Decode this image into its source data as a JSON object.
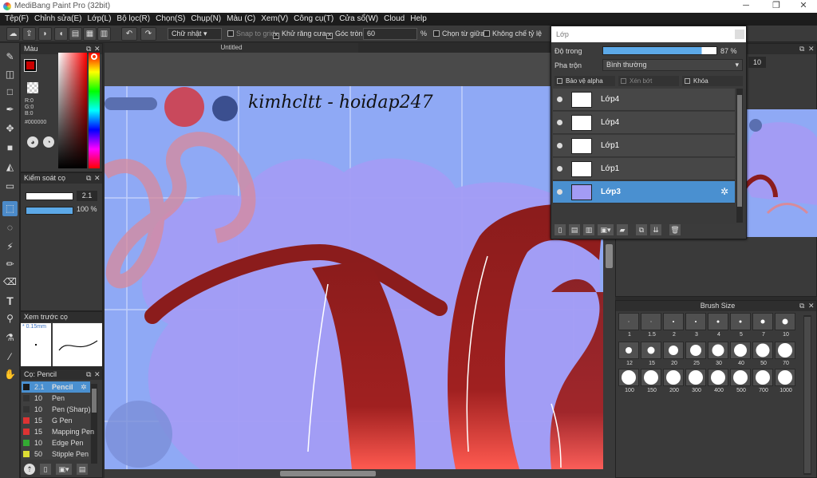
{
  "window": {
    "title": "MediBang Paint Pro (32bit)",
    "minimize": "─",
    "maximize": "❐",
    "close": "✕"
  },
  "menu": [
    "Tệp(F)",
    "Chỉnh sửa(E)",
    "Lớp(L)",
    "Bộ lọc(R)",
    "Chọn(S)",
    "Chụp(N)",
    "Màu (C)",
    "Xem(V)",
    "Công cụ(T)",
    "Cửa sổ(W)",
    "Cloud",
    "Help"
  ],
  "toolbar": {
    "font_select": "Chữ nhật",
    "snap": "Snap to grid",
    "antialias": "Khử răng cưa",
    "round_corner": "Góc tròn",
    "round_value": "60",
    "percent": "%",
    "select_center": "Chọn từ giữa",
    "ratio": "Không chế tỷ lệ"
  },
  "document": {
    "tab": "Untitled",
    "handwriting": "kimhcltt - hoidap247"
  },
  "color_panel": {
    "title": "Màu",
    "r": "R:0",
    "g": "G:0",
    "b": "B:0",
    "hex": "#000000"
  },
  "brush_control": {
    "title": "Kiểm soát cọ",
    "size": "2.1",
    "opacity": "100 %"
  },
  "brush_preview": {
    "title": "Xem trước cọ",
    "size": "0.15mm"
  },
  "brush_list": {
    "title": "Cọ: Pencil",
    "items": [
      {
        "size": "2.1",
        "name": "Pencil",
        "color": "#1a1a1a"
      },
      {
        "size": "10",
        "name": "Pen",
        "color": "#333333"
      },
      {
        "size": "10",
        "name": "Pen (Sharp)",
        "color": "#333333"
      },
      {
        "size": "15",
        "name": "G Pen",
        "color": "#dd3333"
      },
      {
        "size": "15",
        "name": "Mapping Pen",
        "color": "#dd3333"
      },
      {
        "size": "10",
        "name": "Edge Pen",
        "color": "#33aa33"
      },
      {
        "size": "50",
        "name": "Stipple Pen",
        "color": "#dddd33"
      }
    ]
  },
  "layer_panel": {
    "title": "Lớp",
    "opacity_label": "Độ trong",
    "opacity_value": "87 %",
    "blend_label": "Pha trộn",
    "blend_value": "Bình thường",
    "protect_alpha": "Bảo vệ alpha",
    "clipping": "Xén bớt",
    "lock": "Khóa",
    "layers": [
      {
        "name": "Lớp4"
      },
      {
        "name": "Lớp4"
      },
      {
        "name": "Lớp1"
      },
      {
        "name": "Lớp1"
      },
      {
        "name": "Lớp3"
      }
    ],
    "selected_index": 4
  },
  "navigator": {
    "zoom": "10"
  },
  "brush_size": {
    "title": "Brush Size",
    "sizes": [
      "1",
      "1.5",
      "2",
      "3",
      "4",
      "5",
      "7",
      "10",
      "12",
      "15",
      "20",
      "25",
      "30",
      "40",
      "50",
      "70",
      "100",
      "150",
      "200",
      "300",
      "400",
      "500",
      "700",
      "1000"
    ]
  },
  "colors": {
    "accent": "#4a90d0",
    "canvas_bg": "#8fa9f5",
    "blob": "#a39cf4",
    "stroke_red": "#8b1c1c"
  }
}
